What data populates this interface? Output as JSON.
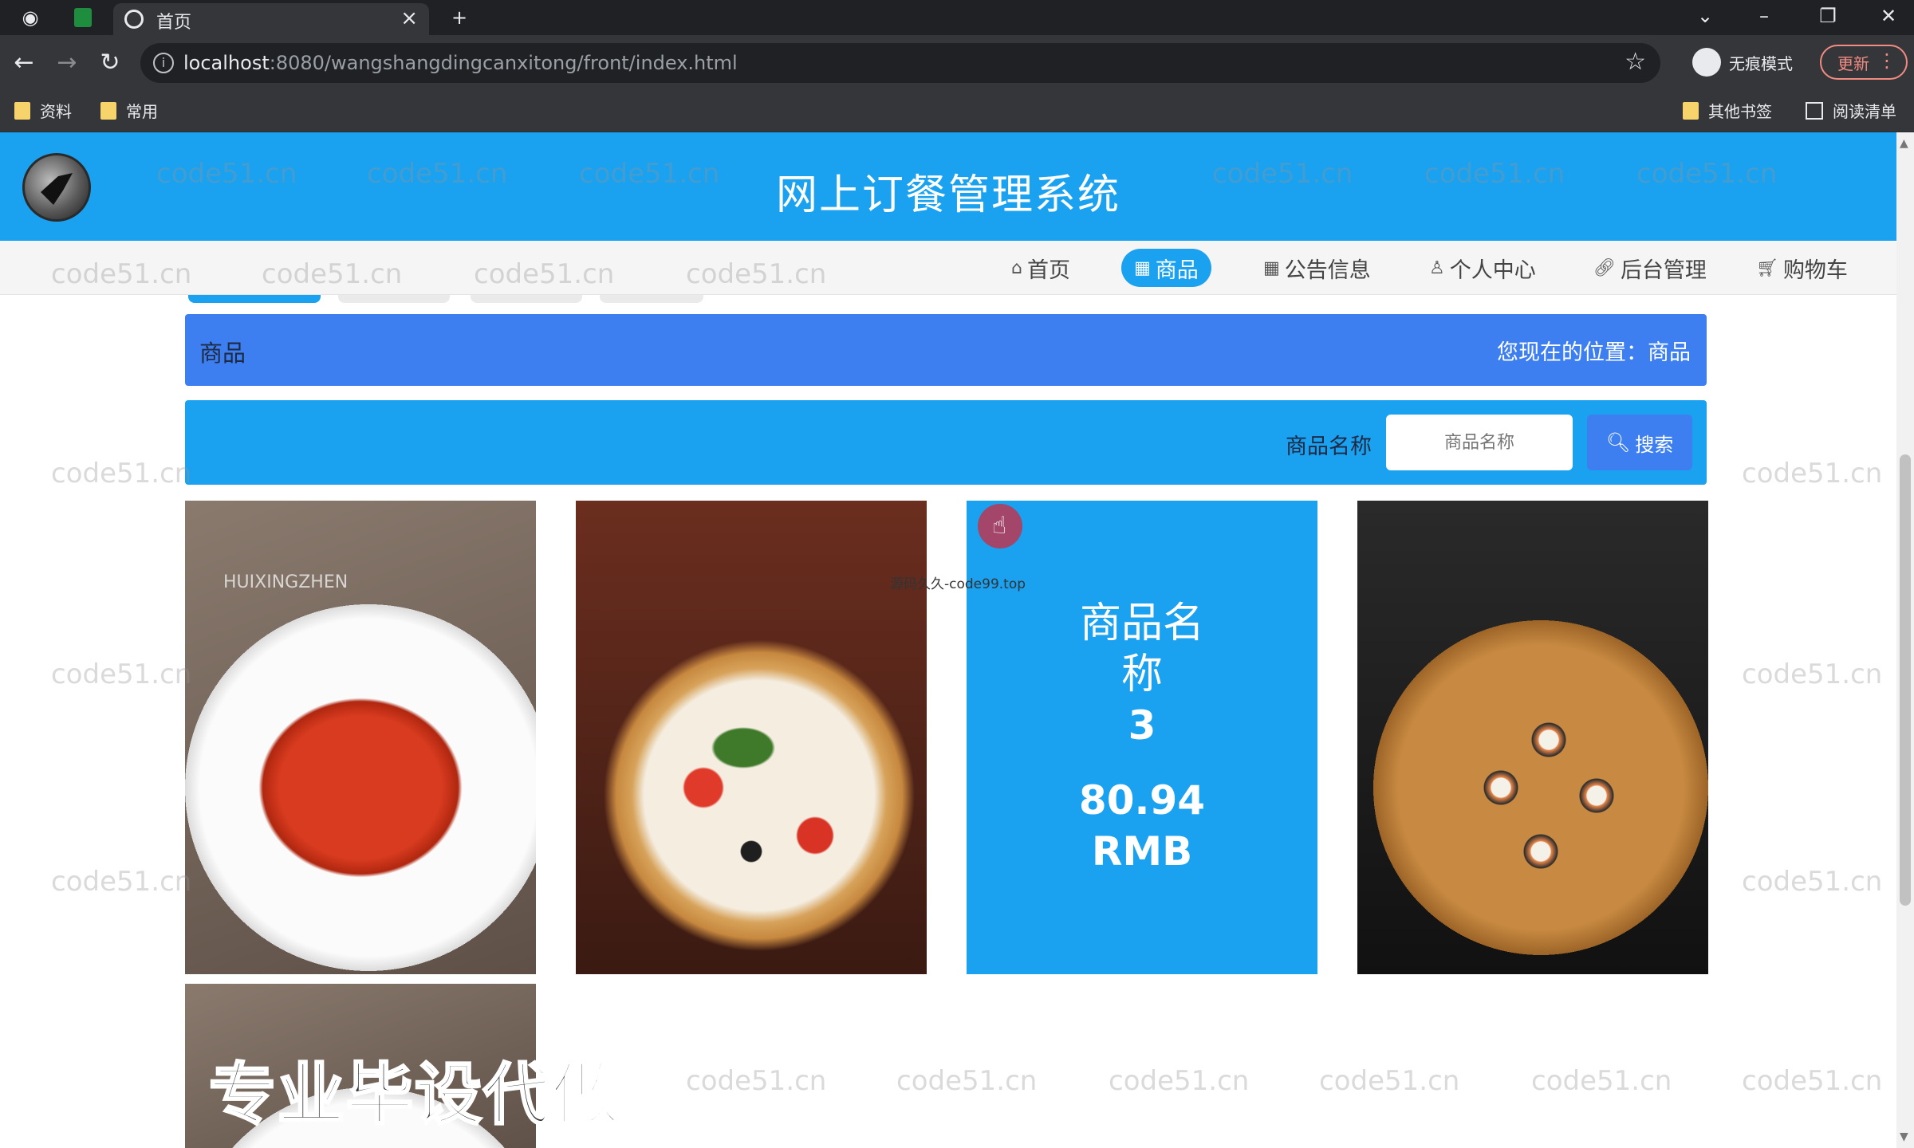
{
  "browser": {
    "tab_title": "首页",
    "new_tab": "+",
    "url_host": "localhost",
    "url_path": ":8080/wangshangdingcanxitong/front/index.html",
    "incognito_label": "无痕模式",
    "update_label": "更新",
    "bookmarks": [
      "资料",
      "常用"
    ],
    "bookmarks_right": [
      "其他书签",
      "阅读清单"
    ]
  },
  "header": {
    "title": "网上订餐管理系统"
  },
  "nav": {
    "items": [
      {
        "icon": "home-icon",
        "label": "首页"
      },
      {
        "icon": "grid-icon",
        "label": "商品"
      },
      {
        "icon": "notice-icon",
        "label": "公告信息"
      },
      {
        "icon": "user-icon",
        "label": "个人中心"
      },
      {
        "icon": "link-icon",
        "label": "后台管理"
      },
      {
        "icon": "cart-icon",
        "label": "购物车"
      }
    ],
    "active": "商品"
  },
  "breadcrumb": {
    "label": "商品",
    "location": "您现在的位置：商品"
  },
  "search": {
    "label": "商品名称",
    "placeholder": "商品名称",
    "button": "搜索"
  },
  "products": [
    {
      "image": "crayfish",
      "sign": "HUIXINGZHEN"
    },
    {
      "image": "pizza"
    },
    {
      "name": "商品名称",
      "number": "3",
      "price": "80.94",
      "currency": "RMB"
    },
    {
      "image": "sushi"
    }
  ],
  "overlays": {
    "small_text": "源码久久-code99.top",
    "big_text": "专业毕设代做",
    "watermark": "code51.cn"
  },
  "colors": {
    "header_blue": "#1aa1f0",
    "crumb_blue": "#3d7ff0",
    "browser_dark": "#202124"
  }
}
